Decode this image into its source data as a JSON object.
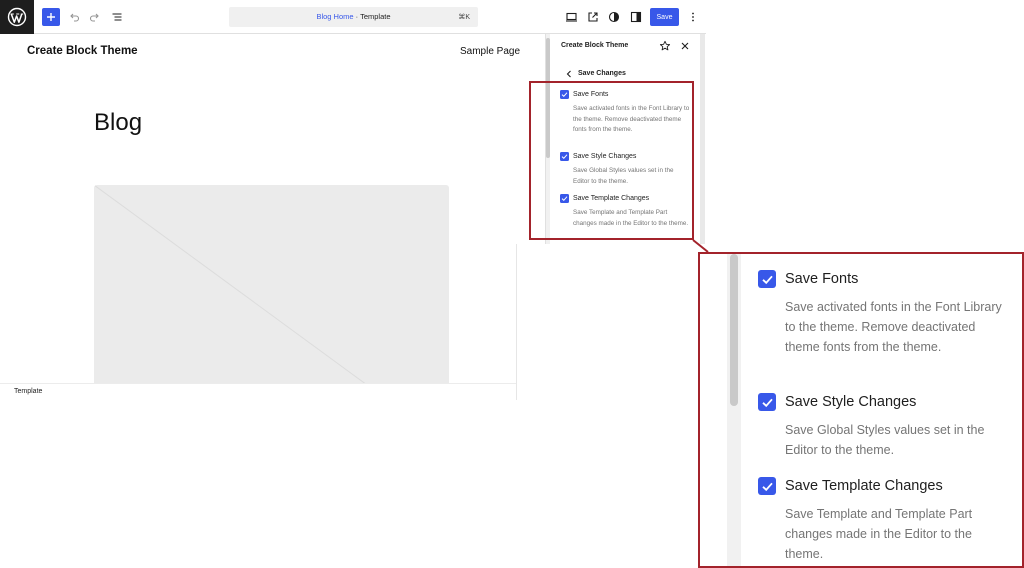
{
  "topbar": {
    "logo_icon": "wordpress-logo-icon",
    "command_page": "Blog Home",
    "command_separator": " · ",
    "command_type": "Template",
    "command_shortcut": "⌘K",
    "save_label": "Save"
  },
  "canvas": {
    "site_title": "Create Block Theme",
    "nav_link": "Sample Page",
    "heading": "Blog",
    "status": "Template"
  },
  "sidebar": {
    "title": "Create Block Theme",
    "section_title": "Save Changes",
    "options": [
      {
        "label": "Save Fonts",
        "desc": "Save activated fonts in the Font Library to the theme. Remove deactivated theme fonts from the theme.",
        "checked": true
      },
      {
        "label": "Save Style Changes",
        "desc": "Save Global Styles values set in the Editor to the theme.",
        "checked": true
      },
      {
        "label": "Save Template Changes",
        "desc": "Save Template and Template Part changes made in the Editor to the theme.",
        "checked": true
      }
    ]
  },
  "colors": {
    "accent": "#3858e9",
    "highlight": "#a3232b"
  }
}
